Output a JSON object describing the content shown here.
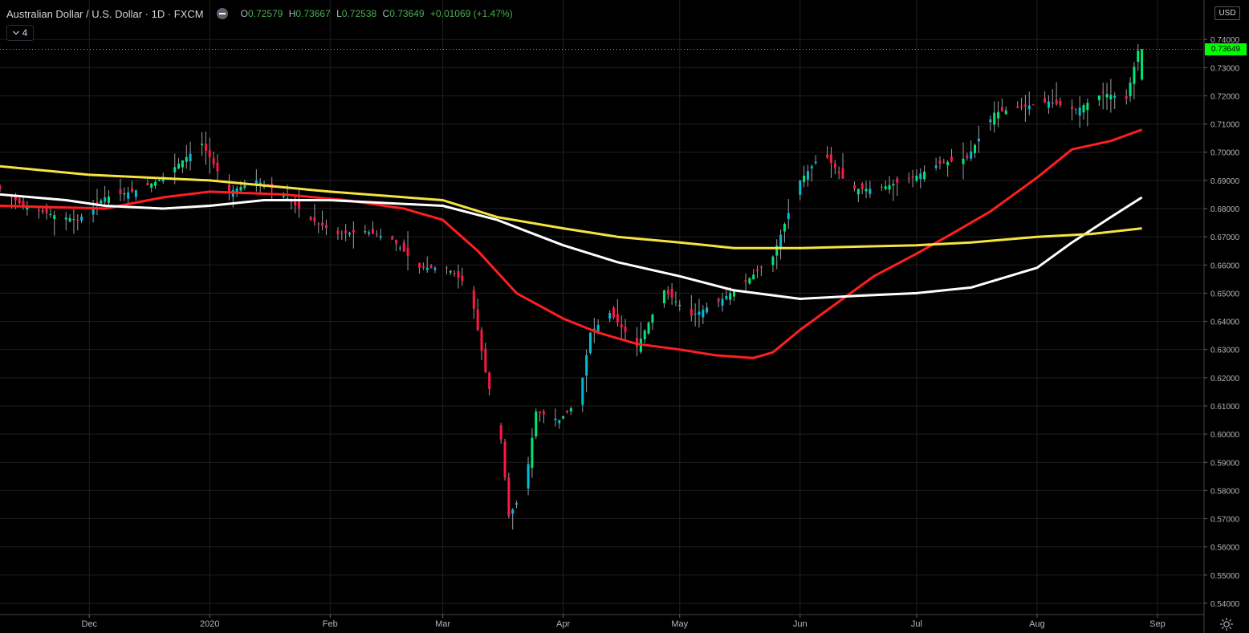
{
  "header": {
    "title": "Australian Dollar / U.S. Dollar · 1D · FXCM",
    "ohlc": {
      "o_label": "O",
      "o_value": "0.72579",
      "h_label": "H",
      "h_value": "0.73667",
      "l_label": "L",
      "l_value": "0.72538",
      "c_label": "C",
      "c_value": "0.73649",
      "change": "+0.01069 (+1.47%)"
    },
    "indicator_count": "4"
  },
  "price_axis": {
    "currency": "USD",
    "last_price_label": "0.73649",
    "last_price_color": "#00ff00",
    "ticks": [
      "0.54000",
      "0.55000",
      "0.56000",
      "0.57000",
      "0.58000",
      "0.59000",
      "0.60000",
      "0.61000",
      "0.62000",
      "0.63000",
      "0.64000",
      "0.65000",
      "0.66000",
      "0.67000",
      "0.68000",
      "0.69000",
      "0.70000",
      "0.71000",
      "0.72000",
      "0.73000",
      "0.74000"
    ]
  },
  "time_axis": {
    "labels": [
      {
        "text": "Dec",
        "date": "2019-12-01"
      },
      {
        "text": "2020",
        "date": "2020-01-01"
      },
      {
        "text": "Feb",
        "date": "2020-02-01"
      },
      {
        "text": "Mar",
        "date": "2020-03-01"
      },
      {
        "text": "Apr",
        "date": "2020-04-01"
      },
      {
        "text": "May",
        "date": "2020-05-01"
      },
      {
        "text": "Jun",
        "date": "2020-06-01"
      },
      {
        "text": "Jul",
        "date": "2020-07-01"
      },
      {
        "text": "Aug",
        "date": "2020-08-01"
      },
      {
        "text": "Sep",
        "date": "2020-09-01"
      }
    ]
  },
  "colors": {
    "background": "#000000",
    "up_body": "#00e676",
    "up_body_alt": "#00bcd4",
    "down_body": "#ff1744",
    "ma_red": "#ff1f1f",
    "ma_white": "#ffffff",
    "ma_yellow": "#f5e342",
    "grid": "#1f1f1f"
  },
  "chart_data": {
    "type": "candlestick",
    "symbol": "AUDUSD",
    "interval": "1D",
    "y_range": [
      0.536,
      0.754
    ],
    "x_range": [
      "2019-11-08",
      "2020-09-13"
    ],
    "last_ohlc": {
      "date": "2020-08-28",
      "open": 0.72579,
      "high": 0.73667,
      "low": 0.72538,
      "close": 0.73649
    },
    "close_path": [
      [
        "2019-11-08",
        0.688
      ],
      [
        "2019-11-15",
        0.681
      ],
      [
        "2019-11-22",
        0.678
      ],
      [
        "2019-11-29",
        0.676
      ],
      [
        "2019-12-06",
        0.684
      ],
      [
        "2019-12-13",
        0.686
      ],
      [
        "2019-12-20",
        0.69
      ],
      [
        "2019-12-31",
        0.703
      ],
      [
        "2020-01-07",
        0.686
      ],
      [
        "2020-01-14",
        0.69
      ],
      [
        "2020-01-21",
        0.685
      ],
      [
        "2020-01-28",
        0.676
      ],
      [
        "2020-02-04",
        0.671
      ],
      [
        "2020-02-11",
        0.672
      ],
      [
        "2020-02-18",
        0.669
      ],
      [
        "2020-02-25",
        0.659
      ],
      [
        "2020-03-03",
        0.659
      ],
      [
        "2020-03-09",
        0.652
      ],
      [
        "2020-03-13",
        0.622
      ],
      [
        "2020-03-17",
        0.598
      ],
      [
        "2020-03-19",
        0.571
      ],
      [
        "2020-03-23",
        0.58
      ],
      [
        "2020-03-26",
        0.608
      ],
      [
        "2020-04-01",
        0.605
      ],
      [
        "2020-04-06",
        0.612
      ],
      [
        "2020-04-09",
        0.636
      ],
      [
        "2020-04-14",
        0.643
      ],
      [
        "2020-04-21",
        0.631
      ],
      [
        "2020-04-28",
        0.651
      ],
      [
        "2020-05-05",
        0.642
      ],
      [
        "2020-05-12",
        0.647
      ],
      [
        "2020-05-19",
        0.654
      ],
      [
        "2020-05-26",
        0.663
      ],
      [
        "2020-06-02",
        0.69
      ],
      [
        "2020-06-08",
        0.7
      ],
      [
        "2020-06-15",
        0.687
      ],
      [
        "2020-06-22",
        0.687
      ],
      [
        "2020-07-01",
        0.691
      ],
      [
        "2020-07-08",
        0.696
      ],
      [
        "2020-07-15",
        0.698
      ],
      [
        "2020-07-22",
        0.714
      ],
      [
        "2020-07-29",
        0.716
      ],
      [
        "2020-08-05",
        0.718
      ],
      [
        "2020-08-12",
        0.715
      ],
      [
        "2020-08-19",
        0.721
      ],
      [
        "2020-08-25",
        0.719
      ],
      [
        "2020-08-28",
        0.736
      ]
    ],
    "series": [
      {
        "color": "#ff1f1f",
        "points": [
          [
            "2019-11-08",
            0.681
          ],
          [
            "2019-12-05",
            0.68
          ],
          [
            "2019-12-20",
            0.684
          ],
          [
            "2020-01-01",
            0.686
          ],
          [
            "2020-01-20",
            0.685
          ],
          [
            "2020-02-05",
            0.683
          ],
          [
            "2020-02-20",
            0.68
          ],
          [
            "2020-03-01",
            0.676
          ],
          [
            "2020-03-10",
            0.665
          ],
          [
            "2020-03-20",
            0.65
          ],
          [
            "2020-04-01",
            0.641
          ],
          [
            "2020-04-10",
            0.636
          ],
          [
            "2020-04-20",
            0.632
          ],
          [
            "2020-05-01",
            0.63
          ],
          [
            "2020-05-10",
            0.628
          ],
          [
            "2020-05-20",
            0.627
          ],
          [
            "2020-05-25",
            0.629
          ],
          [
            "2020-06-01",
            0.637
          ],
          [
            "2020-06-10",
            0.646
          ],
          [
            "2020-06-20",
            0.656
          ],
          [
            "2020-07-01",
            0.664
          ],
          [
            "2020-07-10",
            0.671
          ],
          [
            "2020-07-20",
            0.679
          ],
          [
            "2020-08-01",
            0.691
          ],
          [
            "2020-08-10",
            0.701
          ],
          [
            "2020-08-20",
            0.704
          ],
          [
            "2020-08-28",
            0.708
          ]
        ]
      },
      {
        "color": "#ffffff",
        "points": [
          [
            "2019-11-08",
            0.685
          ],
          [
            "2019-11-25",
            0.683
          ],
          [
            "2019-12-05",
            0.681
          ],
          [
            "2019-12-20",
            0.68
          ],
          [
            "2020-01-01",
            0.681
          ],
          [
            "2020-01-15",
            0.683
          ],
          [
            "2020-02-01",
            0.683
          ],
          [
            "2020-02-15",
            0.682
          ],
          [
            "2020-03-01",
            0.681
          ],
          [
            "2020-03-15",
            0.676
          ],
          [
            "2020-04-01",
            0.667
          ],
          [
            "2020-04-15",
            0.661
          ],
          [
            "2020-05-01",
            0.656
          ],
          [
            "2020-05-15",
            0.651
          ],
          [
            "2020-06-01",
            0.648
          ],
          [
            "2020-06-15",
            0.649
          ],
          [
            "2020-07-01",
            0.65
          ],
          [
            "2020-07-15",
            0.652
          ],
          [
            "2020-08-01",
            0.659
          ],
          [
            "2020-08-10",
            0.668
          ],
          [
            "2020-08-20",
            0.677
          ],
          [
            "2020-08-28",
            0.684
          ]
        ]
      },
      {
        "color": "#f5e342",
        "points": [
          [
            "2019-11-08",
            0.695
          ],
          [
            "2019-12-01",
            0.692
          ],
          [
            "2020-01-01",
            0.69
          ],
          [
            "2020-02-01",
            0.686
          ],
          [
            "2020-03-01",
            0.683
          ],
          [
            "2020-03-15",
            0.677
          ],
          [
            "2020-04-01",
            0.673
          ],
          [
            "2020-04-15",
            0.67
          ],
          [
            "2020-05-01",
            0.668
          ],
          [
            "2020-05-15",
            0.666
          ],
          [
            "2020-06-01",
            0.666
          ],
          [
            "2020-06-15",
            0.6665
          ],
          [
            "2020-07-01",
            0.667
          ],
          [
            "2020-07-15",
            0.668
          ],
          [
            "2020-08-01",
            0.67
          ],
          [
            "2020-08-15",
            0.671
          ],
          [
            "2020-08-28",
            0.673
          ]
        ]
      }
    ]
  }
}
